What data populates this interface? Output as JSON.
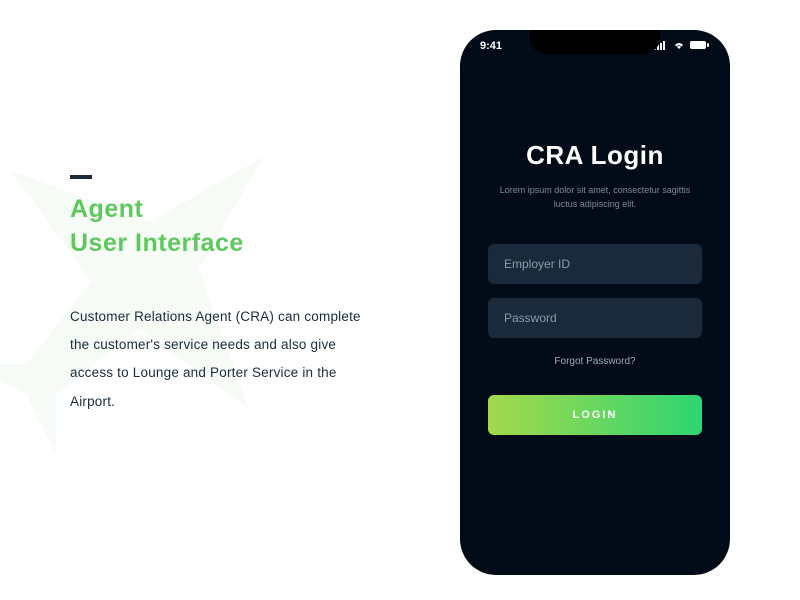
{
  "left": {
    "heading_line1": "Agent",
    "heading_line2": "User Interface",
    "description": "Customer Relations Agent (CRA) can complete the customer's service needs and also give access to Lounge and Porter Service in the Airport."
  },
  "phone": {
    "status": {
      "time": "9:41"
    },
    "login": {
      "title": "CRA Login",
      "subtitle": "Lorem ipsum dolor sit amet, consectetur sagittis luctus adipiscing elit.",
      "employer_placeholder": "Employer ID",
      "password_placeholder": "Password",
      "forgot": "Forgot Password?",
      "button": "LOGIN"
    }
  }
}
